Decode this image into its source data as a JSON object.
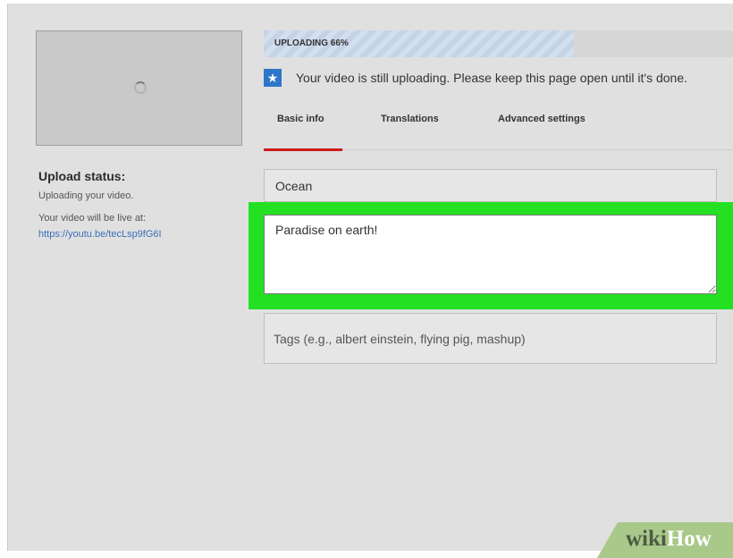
{
  "upload": {
    "progress_label": "UPLOADING 66%",
    "progress_fraction": 0.66,
    "notice_icon": "star-icon",
    "notice_text": "Your video is still uploading. Please keep this page open until it's done."
  },
  "sidebar": {
    "status_title": "Upload status:",
    "status_text": "Uploading your video.",
    "live_label": "Your video will be live at:",
    "live_url": "https://youtu.be/tecLsp9fG6I"
  },
  "tabs": [
    {
      "label": "Basic info",
      "active": true
    },
    {
      "label": "Translations",
      "active": false
    },
    {
      "label": "Advanced settings",
      "active": false
    }
  ],
  "form": {
    "title_value": "Ocean",
    "description_value": "Paradise on earth!",
    "tags_placeholder": "Tags (e.g., albert einstein, flying pig, mashup)"
  },
  "watermark": {
    "part1": "wiki",
    "part2": "How"
  },
  "colors": {
    "accent_red": "#cc1b1b",
    "highlight_green": "#23e023",
    "link_blue": "#3b6fb6",
    "icon_blue": "#2d77c9"
  }
}
